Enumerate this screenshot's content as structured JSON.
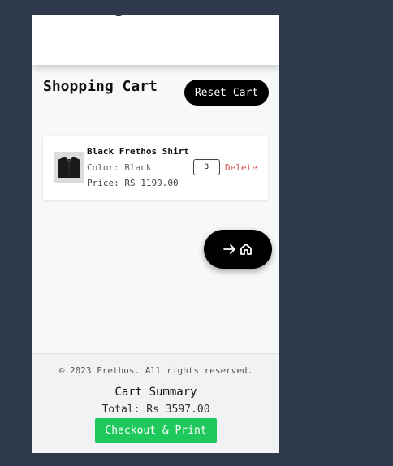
{
  "cart": {
    "title": "Shopping Cart",
    "reset_label": "Reset Cart"
  },
  "items": [
    {
      "name": "Black Frethos Shirt",
      "color_text": "Color: Black",
      "price_text": "Price: RS 1199.00",
      "quantity": "3",
      "delete_label": "Delete"
    }
  ],
  "nav": {
    "home_fab_icons": [
      "arrow-right-icon",
      "home-icon"
    ]
  },
  "footer": {
    "copyright": "© 2023 Frethos. All rights reserved.",
    "summary_title": "Cart Summary",
    "total_text": "Total: Rs 3597.00",
    "checkout_label": "Checkout & Print"
  },
  "colors": {
    "background": "#2e3a4b",
    "checkout": "#1ec85a",
    "delete": "#d9534f",
    "primary_button": "#000000"
  }
}
